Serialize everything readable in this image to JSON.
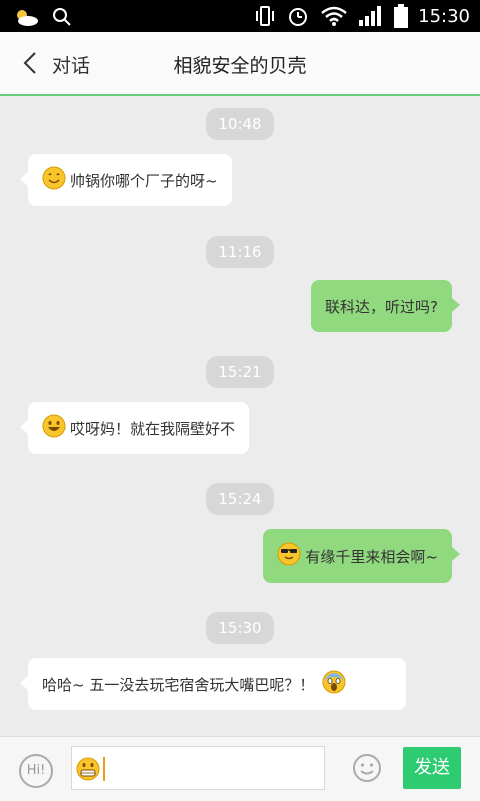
{
  "status_bar": {
    "time": "15:30",
    "icons": [
      "weather-partly-cloudy-icon",
      "search-icon",
      "vibrate-icon",
      "alarm-icon",
      "wifi-icon",
      "signal-icon",
      "battery-icon"
    ]
  },
  "header": {
    "back_label": "对话",
    "title": "相貌安全的贝壳"
  },
  "messages": [
    {
      "time": "10:48",
      "direction": "incoming",
      "emoji": "smile",
      "text": "帅锅你哪个厂子的呀~"
    },
    {
      "time": "11:16",
      "direction": "outgoing",
      "emoji": null,
      "text": "联科达，听过吗?"
    },
    {
      "time": "15:21",
      "direction": "incoming",
      "emoji": "grin",
      "text": "哎呀妈！就在我隔壁好不"
    },
    {
      "time": "15:24",
      "direction": "outgoing",
      "emoji": "cool",
      "text": "有缘千里来相会啊~"
    },
    {
      "time": "15:30",
      "direction": "incoming",
      "emoji": "scream",
      "text": "哈哈~ 五一没去玩宅宿舍玩大嘴巴呢？！"
    }
  ],
  "input_bar": {
    "hi_label": "Hi!",
    "input_emoji": "grimace",
    "send_label": "发送"
  },
  "colors": {
    "accent": "#2ecc71",
    "outgoing_bubble": "#91d97f",
    "incoming_bubble": "#ffffff",
    "background": "#ececec",
    "time_badge": "#d7d7d7"
  }
}
